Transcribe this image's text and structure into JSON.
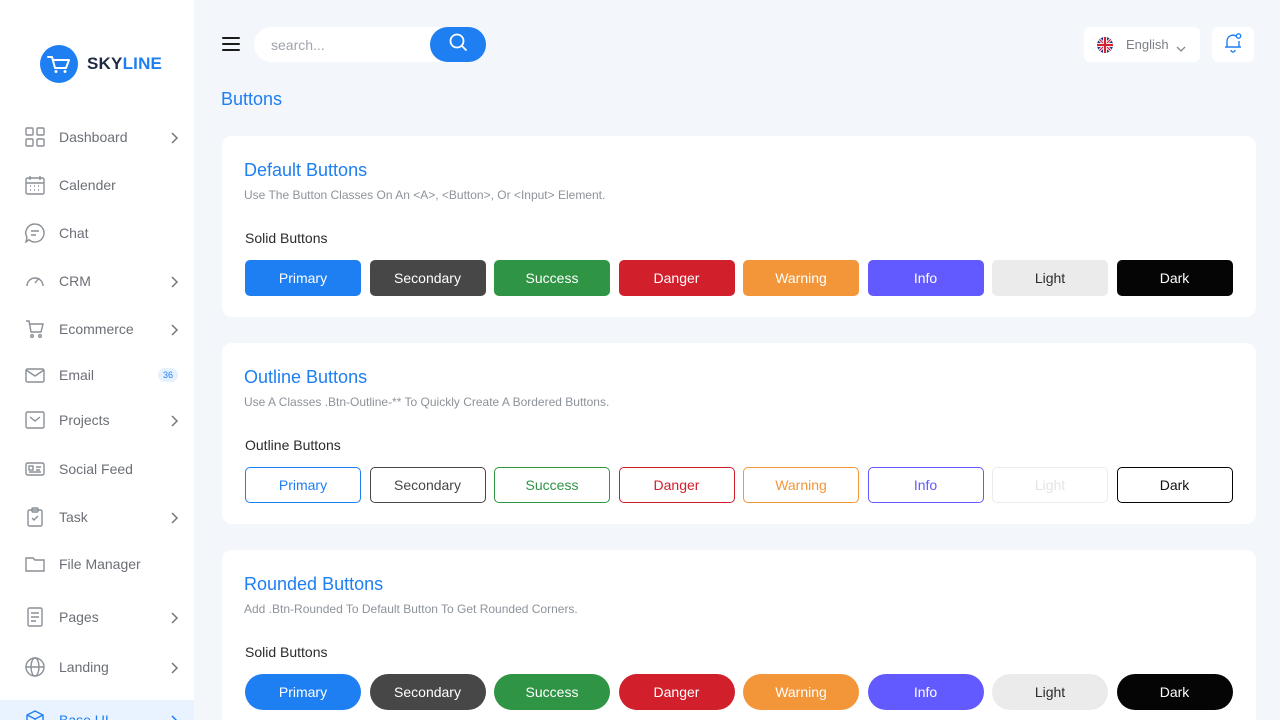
{
  "brand": {
    "part1": "SKY",
    "part2": "LINE",
    "color": "#1e7ff2"
  },
  "sidebar": {
    "items": [
      {
        "label": "Dashboard",
        "icon": "grid-icon",
        "chevron": true
      },
      {
        "label": "Calender",
        "icon": "calendar-icon",
        "chevron": false
      },
      {
        "label": "Chat",
        "icon": "chat-icon",
        "chevron": false
      },
      {
        "label": "CRM",
        "icon": "gauge-icon",
        "chevron": true
      },
      {
        "label": "Ecommerce",
        "icon": "cart-icon",
        "chevron": true
      },
      {
        "label": "Email",
        "icon": "mail-icon",
        "badge": "36"
      },
      {
        "label": "Projects",
        "icon": "inbox-icon",
        "chevron": true
      },
      {
        "label": "Social Feed",
        "icon": "id-card-icon",
        "chevron": false
      },
      {
        "label": "Task",
        "icon": "clipboard-icon",
        "chevron": true
      },
      {
        "label": "File Manager",
        "icon": "folder-icon",
        "chevron": false
      },
      {
        "label": "Pages",
        "icon": "document-icon",
        "chevron": true
      },
      {
        "label": "Landing",
        "icon": "globe-icon",
        "chevron": true
      },
      {
        "label": "Base UI",
        "icon": "cube-icon",
        "chevron": true
      }
    ]
  },
  "topbar": {
    "search_placeholder": "search...",
    "language": "English"
  },
  "page": {
    "title": "Buttons"
  },
  "cards": [
    {
      "title": "Default Buttons",
      "desc": "Use The Button Classes On An <A>, <Button>, Or <Input> Element.",
      "subtitle": "Solid Buttons"
    },
    {
      "title": "Outline Buttons",
      "desc": "Use A Classes .Btn-Outline-** To Quickly Create A Bordered Buttons.",
      "subtitle": "Outline Buttons"
    },
    {
      "title": "Rounded Buttons",
      "desc": "Add .Btn-Rounded To Default Button To Get Rounded Corners.",
      "subtitle": "Solid Buttons"
    }
  ],
  "buttons": [
    {
      "label": "Primary",
      "color": "#1e7ff2",
      "text": "#ffffff"
    },
    {
      "label": "Secondary",
      "color": "#474747",
      "text": "#ffffff"
    },
    {
      "label": "Success",
      "color": "#2f9444",
      "text": "#ffffff"
    },
    {
      "label": "Danger",
      "color": "#d11f2c",
      "text": "#ffffff"
    },
    {
      "label": "Warning",
      "color": "#f3963a",
      "text": "#ffffff"
    },
    {
      "label": "Info",
      "color": "#6259ff",
      "text": "#ffffff"
    },
    {
      "label": "Light",
      "color": "#ebebeb",
      "text": "#2b2b2b"
    },
    {
      "label": "Dark",
      "color": "#050505",
      "text": "#ffffff"
    }
  ]
}
